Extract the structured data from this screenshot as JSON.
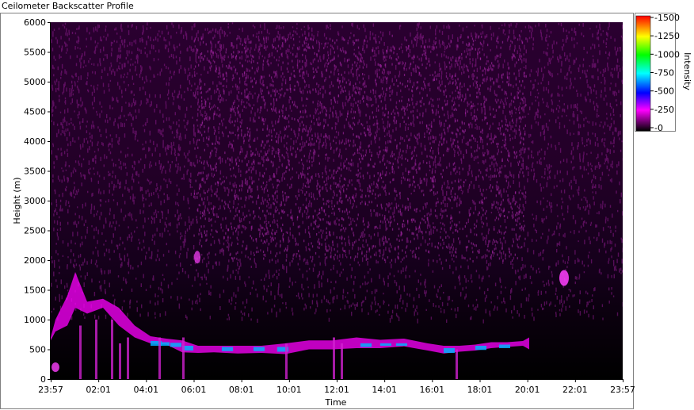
{
  "window": {
    "title": "Ceilometer Backscatter Profile"
  },
  "chart_data": {
    "type": "heatmap",
    "title": "Ceilometer Backscatter Profile",
    "xlabel": "Time",
    "ylabel": "Height (m)",
    "x_ticks": [
      "23:57",
      "02:01",
      "04:01",
      "06:01",
      "08:01",
      "10:01",
      "12:01",
      "14:01",
      "16:01",
      "18:01",
      "20:01",
      "22:01",
      "23:57"
    ],
    "y_ticks": [
      "0",
      "500",
      "1000",
      "1500",
      "2000",
      "2500",
      "3000",
      "3500",
      "4000",
      "4500",
      "5000",
      "5500",
      "6000"
    ],
    "ylim": [
      0,
      6000
    ],
    "colorbar": {
      "label": "Intensity",
      "ticks": [
        "0",
        "250",
        "500",
        "750",
        "1000",
        "1250",
        "1500"
      ],
      "range": [
        0,
        1500
      ],
      "colors": [
        "#000000",
        "#ff00ff",
        "#0000ff",
        "#00ffff",
        "#00ff00",
        "#ffff00",
        "#ff0000"
      ]
    },
    "features": [
      {
        "name": "boundary layer",
        "time_range": [
          "23:57",
          "20:01"
        ],
        "height_m": [
          400,
          700
        ],
        "max_intensity": 700
      },
      {
        "name": "high clutter",
        "height_m": [
          1000,
          6000
        ],
        "intensity": 150
      },
      {
        "name": "isolated cloud",
        "time": "21:30",
        "height_m": [
          1600,
          1800
        ],
        "intensity": 250
      }
    ],
    "grid": false
  }
}
